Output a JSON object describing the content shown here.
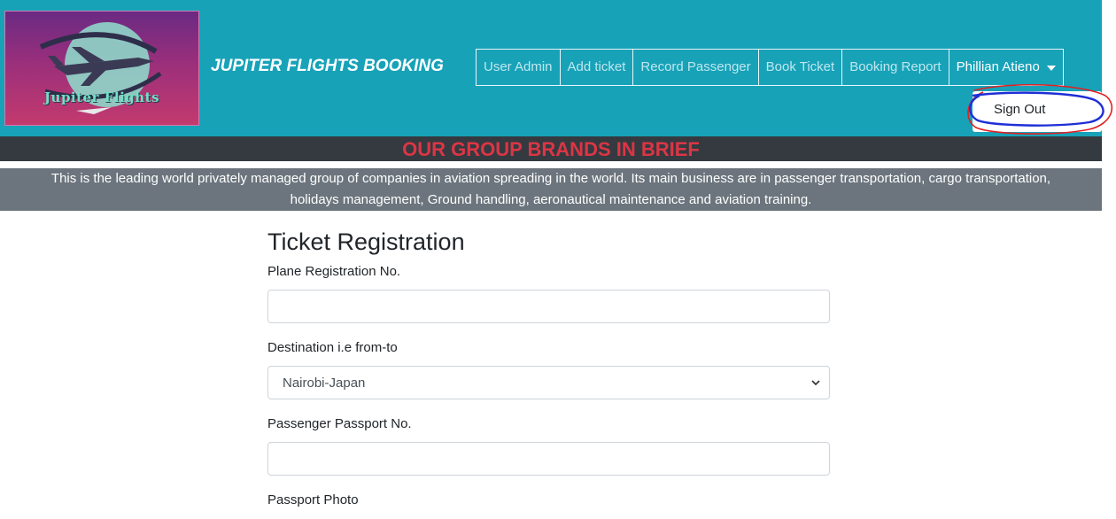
{
  "logo": {
    "text": "Jupiter Flights"
  },
  "brand": {
    "title": "JUPITER FLIGHTS BOOKING"
  },
  "nav": {
    "items": [
      "User Admin",
      "Add ticket",
      "Record Passenger",
      "Book Ticket",
      "Booking Report"
    ],
    "user": "Phillian Atieno",
    "dropdown": {
      "sign_out": "Sign Out"
    }
  },
  "brands": {
    "title": "OUR GROUP BRANDS IN BRIEF",
    "line1": "This is the leading world privately managed group of companies in aviation spreading in the world. Its main business are in passenger transportation, cargo transportation,",
    "line2": "holidays management, Ground handling, aeronautical maintenance and aviation training."
  },
  "form": {
    "title": "Ticket Registration",
    "plane_reg_label": "Plane Registration No.",
    "plane_reg_value": "",
    "destination_label": "Destination i.e from-to",
    "destination_value": "Nairobi-Japan",
    "passport_label": "Passenger Passport No.",
    "passport_value": "",
    "photo_label": "Passport Photo"
  },
  "colors": {
    "navbar": "#17a2b8",
    "brands_bar": "#343a40",
    "brands_title": "#dc3545",
    "desc_bar": "#6c757d",
    "annotation_red": "#e02020",
    "annotation_blue": "#1e2fd6"
  }
}
